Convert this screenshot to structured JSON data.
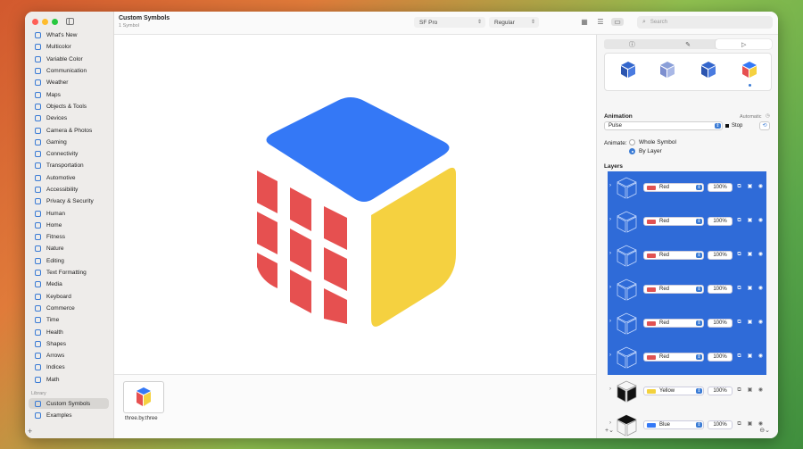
{
  "document": {
    "title": "Custom Symbols",
    "subtitle": "1 Symbol"
  },
  "toolbar": {
    "font_select": "SF Pro",
    "weight_select": "Regular",
    "search_placeholder": "Search"
  },
  "sidebar": {
    "categories": [
      "What's New",
      "Multicolor",
      "Variable Color",
      "Communication",
      "Weather",
      "Maps",
      "Objects & Tools",
      "Devices",
      "Camera & Photos",
      "Gaming",
      "Connectivity",
      "Transportation",
      "Automotive",
      "Accessibility",
      "Privacy & Security",
      "Human",
      "Home",
      "Fitness",
      "Nature",
      "Editing",
      "Text Formatting",
      "Media",
      "Keyboard",
      "Commerce",
      "Time",
      "Health",
      "Shapes",
      "Arrows",
      "Indices",
      "Math"
    ],
    "library_title": "Library",
    "library_items": [
      "Custom Symbols",
      "Examples"
    ],
    "add_label": "+"
  },
  "gallery": {
    "thumb_label": "three.by.three"
  },
  "inspector": {
    "animation_title": "Animation",
    "automatic_label": "Automatic",
    "animation_value": "Pulse",
    "stop_label": "Stop",
    "animate_label": "Animate:",
    "animate_options": [
      "Whole Symbol",
      "By Layer"
    ],
    "layers_title": "Layers",
    "layers": [
      {
        "color": "Red",
        "opacity": "100%",
        "swatch": "#e05252",
        "selected": true
      },
      {
        "color": "Red",
        "opacity": "100%",
        "swatch": "#e05252",
        "selected": true
      },
      {
        "color": "Red",
        "opacity": "100%",
        "swatch": "#e05252",
        "selected": true
      },
      {
        "color": "Red",
        "opacity": "100%",
        "swatch": "#e05252",
        "selected": true
      },
      {
        "color": "Red",
        "opacity": "100%",
        "swatch": "#e05252",
        "selected": true
      },
      {
        "color": "Red",
        "opacity": "100%",
        "swatch": "#e05252",
        "selected": true
      },
      {
        "color": "Yellow",
        "opacity": "100%",
        "swatch": "#f2d13e",
        "selected": false
      },
      {
        "color": "Blue",
        "opacity": "100%",
        "swatch": "#3478f6",
        "selected": false
      }
    ],
    "footer_left": "+⌄",
    "footer_right": "⊖⌄"
  },
  "colors": {
    "cube_top": "#3478f6",
    "cube_right": "#f5d140",
    "cube_left": "#e65050",
    "selection": "#2f6bd8",
    "accent": "#3a7bd5"
  }
}
